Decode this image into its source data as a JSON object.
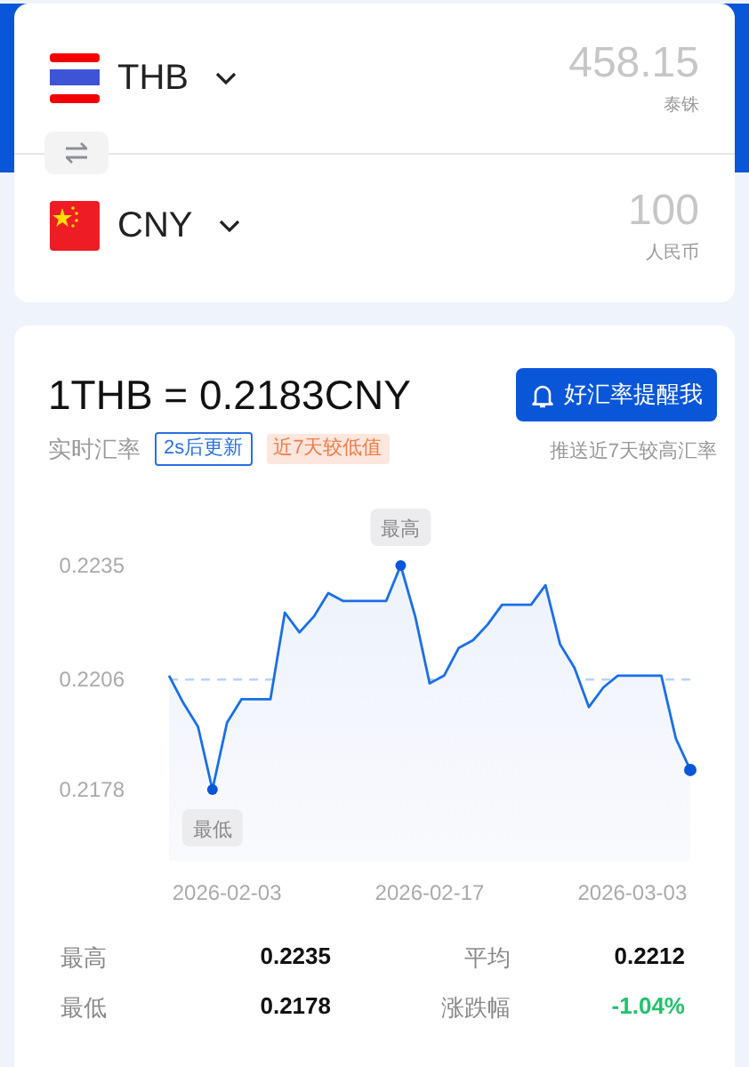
{
  "converter": {
    "rows": [
      {
        "kind": "th",
        "code": "THB",
        "amount": "458.15",
        "name": "泰铢"
      },
      {
        "kind": "cn",
        "code": "CNY",
        "amount": "100",
        "name": "人民币"
      }
    ]
  },
  "rate": {
    "title": "1THB = 0.2183CNY",
    "label": "实时汇率",
    "update_tag": "2s后更新",
    "trend_tag": "近7天较低值",
    "alert_button": "好汇率提醒我",
    "alert_hint": "推送近7天较高汇率"
  },
  "chart_data": {
    "type": "area",
    "categories": [
      null,
      null,
      null,
      null,
      "2026-02-03",
      null,
      null,
      null,
      null,
      null,
      null,
      null,
      null,
      null,
      null,
      null,
      null,
      null,
      "2026-02-17",
      null,
      null,
      null,
      null,
      null,
      null,
      null,
      null,
      null,
      null,
      null,
      null,
      null,
      "2026-03-03",
      null,
      null,
      null,
      null
    ],
    "series": [
      {
        "color": "#1a6fe6",
        "values": [
          0.2207,
          0.22,
          0.2194,
          0.2178,
          0.2195,
          0.2201,
          0.2201,
          0.2201,
          0.2223,
          0.2218,
          0.2222,
          0.2228,
          0.2226,
          0.2226,
          0.2226,
          0.2226,
          0.2235,
          0.2222,
          0.2205,
          0.2207,
          0.2214,
          0.2216,
          0.222,
          0.2225,
          0.2225,
          0.2225,
          0.223,
          0.2215,
          0.2209,
          0.2199,
          0.2204,
          0.2207,
          0.2207,
          0.2207,
          0.2207,
          0.2191,
          0.2183
        ]
      }
    ],
    "ylim": [
      0.2178,
      0.2235
    ],
    "yticks": [
      0.2178,
      0.2206,
      0.2235
    ],
    "ref_lines": [
      {
        "axis": "y",
        "value": 0.2206
      }
    ],
    "annotations": [
      {
        "text": "最高",
        "y": 0.2235
      },
      {
        "text": "最低",
        "y": 0.2178
      }
    ]
  },
  "stats": [
    {
      "label": "最高",
      "value": "0.2235"
    },
    {
      "label": "平均",
      "value": "0.2212"
    },
    {
      "label": "最低",
      "value": "0.2178"
    },
    {
      "label": "涨跌幅",
      "value": "-1.04%",
      "color": "#22c36b"
    }
  ]
}
